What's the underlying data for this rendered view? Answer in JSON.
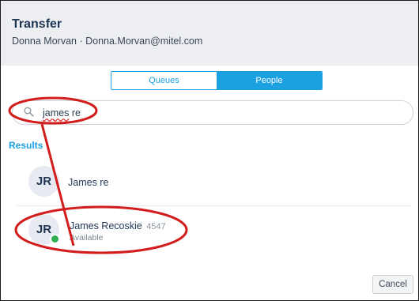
{
  "dialog": {
    "title": "Transfer",
    "subtitle": "Donna Morvan · Donna.Morvan@mitel.com"
  },
  "toggle": {
    "tabs": [
      {
        "label": "Queues",
        "active": false
      },
      {
        "label": "People",
        "active": true
      }
    ]
  },
  "search": {
    "icon": "search-icon",
    "value": "james re",
    "typed_word1": "james",
    "typed_rest": " re"
  },
  "results": {
    "label": "Results",
    "items": [
      {
        "initials": "JR",
        "name": "James re"
      },
      {
        "initials": "JR",
        "name": "James Recoskie",
        "extension": "4547",
        "status": "Available",
        "presence": "available"
      }
    ]
  },
  "footer": {
    "cancel_label": "Cancel"
  },
  "colors": {
    "accent": "#1ba0e2",
    "header_bg": "#eceef1",
    "presence_available": "#2fae52",
    "annotation_red": "#d31c1c"
  }
}
